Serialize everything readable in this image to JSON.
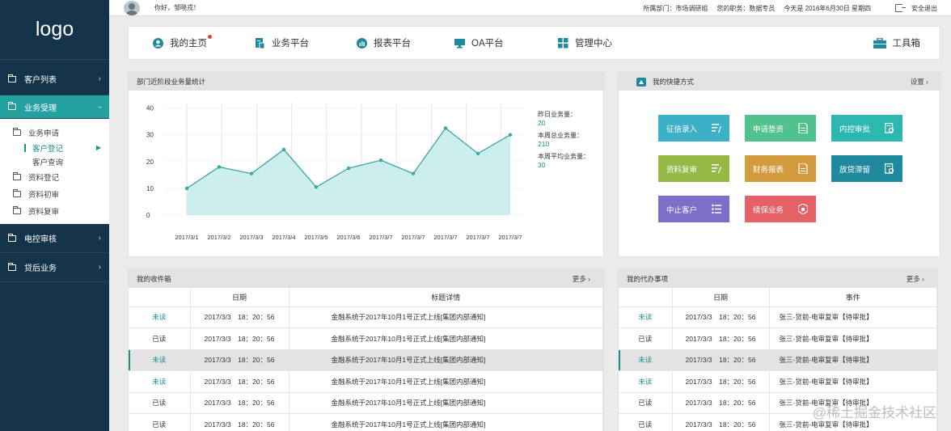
{
  "sidebar": {
    "logo": "logo",
    "items": [
      {
        "label": "客户列表"
      },
      {
        "label": "业务受理"
      }
    ],
    "sub_items": [
      {
        "label": "业务申请"
      },
      {
        "label": "资料登记"
      },
      {
        "label": "资料初审"
      },
      {
        "label": "资料复审"
      }
    ],
    "sub_sub_items": [
      {
        "label": "客户登记"
      },
      {
        "label": "客户查询"
      }
    ],
    "bottom_items": [
      {
        "label": "电控审核"
      },
      {
        "label": "贷后业务"
      }
    ]
  },
  "topbar": {
    "greeting": "你好，邹晓戎！",
    "department": "所属部门：市场调研组",
    "position": "您的职务：数据专员",
    "date": "今天是 2016年6月30日 星期四",
    "logout": "安全退出"
  },
  "mainnav": {
    "items": [
      {
        "label": "我的主页"
      },
      {
        "label": "业务平台"
      },
      {
        "label": "报表平台"
      },
      {
        "label": "OA平台"
      },
      {
        "label": "管理中心"
      }
    ],
    "toolbox": "工具箱"
  },
  "chart_panel": {
    "title": "部门近阶段业务量统计",
    "stats": [
      {
        "label": "昨日业务量：",
        "value": "20"
      },
      {
        "label": "本周总业务量：",
        "value": "210"
      },
      {
        "label": "本周平均业务量：",
        "value": "30"
      }
    ]
  },
  "chart_data": {
    "type": "area",
    "title": "",
    "xlabel": "",
    "ylabel": "",
    "categories": [
      "2017/3/1",
      "2017/3/2",
      "2017/3/3",
      "2017/3/4",
      "2017/3/5",
      "2017/3/6",
      "2017/3/7",
      "2017/3/7",
      "2017/3/7",
      "2017/3/7",
      "2017/3/7"
    ],
    "values": [
      10,
      18,
      15.5,
      24.5,
      10.5,
      17.5,
      20.5,
      15.5,
      32.5,
      23,
      30
    ],
    "yticks": [
      0,
      10,
      20,
      30,
      40
    ],
    "ylim": [
      0,
      42
    ],
    "grid": true,
    "colors": {
      "line": "#3aa8a0",
      "fill": "#cdeeee"
    }
  },
  "shortcuts": {
    "title": "我的快捷方式",
    "settings": "设置",
    "tiles": [
      {
        "label": "征信录入",
        "color": "#3bb0c6",
        "icon": "list-edit-icon"
      },
      {
        "label": "申请垫资",
        "color": "#4fc28d",
        "icon": "document-icon"
      },
      {
        "label": "内控审批",
        "color": "#2cb8b0",
        "icon": "approve-icon"
      },
      {
        "label": "资料复审",
        "color": "#96b845",
        "icon": "list-edit-icon"
      },
      {
        "label": "财务报表",
        "color": "#d29b3e",
        "icon": "document-icon"
      },
      {
        "label": "放贷滞留",
        "color": "#1f8a9e",
        "icon": "approve-icon"
      },
      {
        "label": "中止客户",
        "color": "#7c6fc7",
        "icon": "list-icon"
      },
      {
        "label": "续保业务",
        "color": "#e56166",
        "icon": "shield-icon"
      }
    ]
  },
  "inbox": {
    "title": "我的收件箱",
    "more": "更多",
    "columns": [
      "",
      "日期",
      "标题详情"
    ],
    "rows": [
      {
        "status": "未读",
        "date": "2017/3/3　18：20：56",
        "title": "金融系统于2017年10月1号正式上线[集团内部通知]"
      },
      {
        "status": "已读",
        "date": "2017/3/3　18：20：56",
        "title": "金融系统于2017年10月1号正式上线[集团内部通知]"
      },
      {
        "status": "未读",
        "date": "2017/3/3　18：20：56",
        "title": "金融系统于2017年10月1号正式上线[集团内部通知]"
      },
      {
        "status": "未读",
        "date": "2017/3/3　18：20：56",
        "title": "金融系统于2017年10月1号正式上线[集团内部通知]"
      },
      {
        "status": "已读",
        "date": "2017/3/3　18：20：56",
        "title": "金融系统于2017年10月1号正式上线[集团内部通知]"
      },
      {
        "status": "已读",
        "date": "2017/3/3　18：20：56",
        "title": "金融系统于2017年10月1号正式上线[集团内部通知]"
      }
    ]
  },
  "todo": {
    "title": "我的代办事项",
    "more": "更多",
    "columns": [
      "",
      "日期",
      "事件"
    ],
    "rows": [
      {
        "status": "未读",
        "date": "2017/3/3　18：20：56",
        "event": "张三-贷前-电审复审【待审批】"
      },
      {
        "status": "已读",
        "date": "2017/3/3　18：20：56",
        "event": "张三-贷前-电审复审【待审批】"
      },
      {
        "status": "未读",
        "date": "2017/3/3　18：20：56",
        "event": "张三-贷前-电审复审【待审批】"
      },
      {
        "status": "未读",
        "date": "2017/3/3　18：20：56",
        "event": "张三-贷前-电审复审【待审批】"
      },
      {
        "status": "已读",
        "date": "2017/3/3　18：20：56",
        "event": "张三-贷前-电审复审【待审批】"
      },
      {
        "status": "已读",
        "date": "2017/3/3　18：20：56",
        "event": "张三-贷前-电审复审【待审批】"
      }
    ]
  },
  "watermark": "@稀土掘金技术社区",
  "colors": {
    "accent": "#23a1a1",
    "sidebar": "#14344a"
  }
}
